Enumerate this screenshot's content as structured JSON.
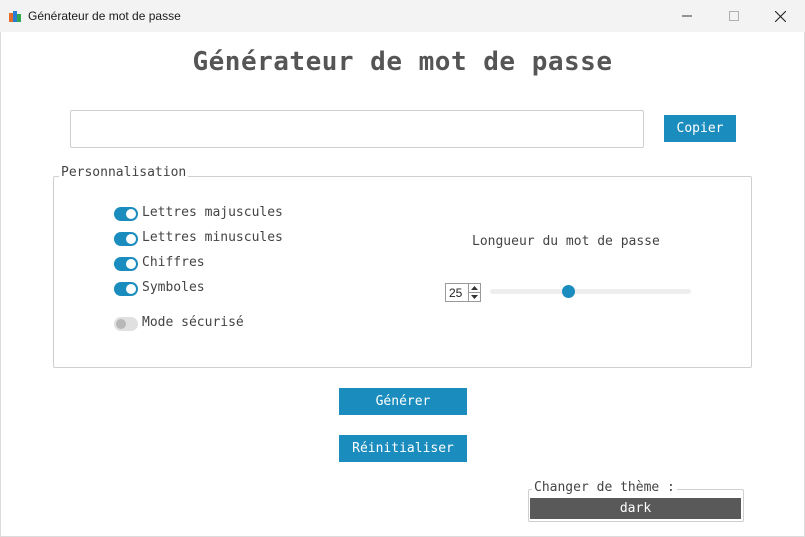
{
  "window": {
    "title": "Générateur de mot de passe",
    "controls": {
      "minimize": "minimize-icon",
      "maximize": "maximize-icon",
      "close": "close-icon"
    }
  },
  "app": {
    "title": "Générateur de mot de passe"
  },
  "password": {
    "value": "",
    "copy_label": "Copier"
  },
  "options": {
    "group_title": "Personnalisation",
    "items": [
      {
        "label": "Lettres majuscules",
        "checked": true
      },
      {
        "label": "Lettres minuscules",
        "checked": true
      },
      {
        "label": "Chiffres",
        "checked": true
      },
      {
        "label": "Symboles",
        "checked": true
      },
      {
        "label": "Mode sécurisé",
        "checked": false
      }
    ],
    "length": {
      "label": "Longueur du mot de passe",
      "value": "25"
    }
  },
  "actions": {
    "generate_label": "Générer",
    "reset_label": "Réinitialiser"
  },
  "theme": {
    "title": "Changer de thème :",
    "value": "dark"
  },
  "colors": {
    "accent": "#1a8cbd",
    "theme_select_bg": "#595959",
    "title_text": "#555555"
  }
}
